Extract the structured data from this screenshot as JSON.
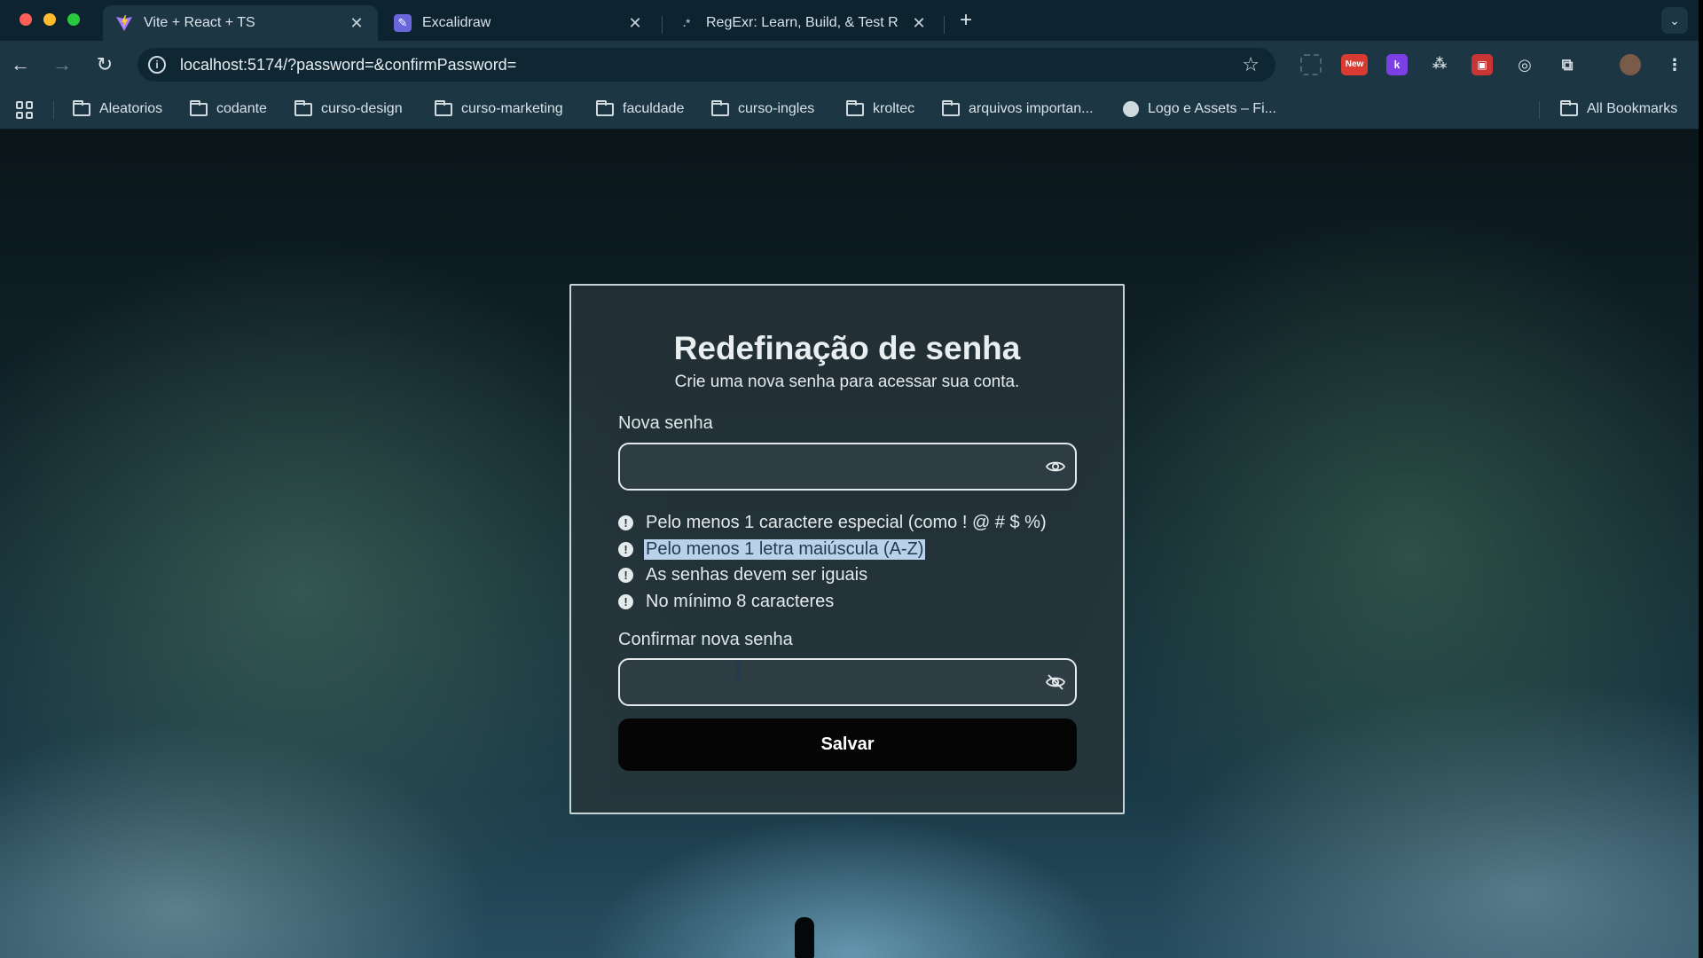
{
  "browser": {
    "tabs": [
      {
        "title": "Vite + React + TS",
        "active": true,
        "icon": "vite-icon"
      },
      {
        "title": "Excalidraw",
        "active": false,
        "icon": "excalidraw-icon"
      },
      {
        "title": "RegExr: Learn, Build, & Test R",
        "active": false,
        "icon": "regexr-icon"
      }
    ],
    "url": "localhost:5174/?password=&confirmPassword=",
    "extensions": [
      {
        "name": "new-extension-icon",
        "label": "New",
        "color": "#d93a32"
      },
      {
        "name": "k-extension-icon",
        "label": "k",
        "color": "#7b3fe4"
      }
    ],
    "bookmarks": [
      {
        "label": "Aleatorios",
        "icon": "folder-icon"
      },
      {
        "label": "codante",
        "icon": "folder-icon"
      },
      {
        "label": "curso-design",
        "icon": "folder-icon"
      },
      {
        "label": "curso-marketing",
        "icon": "folder-icon"
      },
      {
        "label": "faculdade",
        "icon": "folder-icon"
      },
      {
        "label": "curso-ingles",
        "icon": "folder-icon"
      },
      {
        "label": "kroltec",
        "icon": "folder-icon"
      },
      {
        "label": "arquivos importan...",
        "icon": "folder-icon"
      },
      {
        "label": "Logo e Assets – Fi...",
        "icon": "globe-icon"
      }
    ],
    "all_bookmarks": "All Bookmarks"
  },
  "form": {
    "title": "Redefinação de senha",
    "subtitle": "Crie uma nova senha para acessar sua conta.",
    "new_password": {
      "label": "Nova senha",
      "value": "",
      "placeholder": ""
    },
    "rules": [
      {
        "text": "Pelo menos 1 caractere especial (como ! @ # $ %)",
        "selected": false
      },
      {
        "text": "Pelo menos 1 letra maiúscula (A-Z)",
        "selected": true
      },
      {
        "text": "As senhas devem ser iguais",
        "selected": false
      },
      {
        "text": "No mínimo 8 caracteres",
        "selected": false
      }
    ],
    "rule_icon": "!",
    "confirm_password": {
      "label": "Confirmar nova senha",
      "value": "",
      "placeholder": ""
    },
    "save_label": "Salvar"
  }
}
